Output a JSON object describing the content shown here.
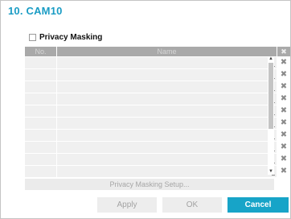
{
  "dialog": {
    "title": "10. CAM10"
  },
  "privacy_masking": {
    "label": "Privacy Masking",
    "checked": false
  },
  "table": {
    "columns": {
      "no": "No.",
      "name": "Name",
      "delete_icon": "close-icon"
    },
    "delete_glyph": "✖",
    "rows": [
      {
        "no": "",
        "name": ""
      },
      {
        "no": "",
        "name": ""
      },
      {
        "no": "",
        "name": ""
      },
      {
        "no": "",
        "name": ""
      },
      {
        "no": "",
        "name": ""
      },
      {
        "no": "",
        "name": ""
      },
      {
        "no": "",
        "name": ""
      },
      {
        "no": "",
        "name": ""
      },
      {
        "no": "",
        "name": ""
      },
      {
        "no": "",
        "name": ""
      }
    ]
  },
  "setup_button": "Privacy Masking Setup...",
  "buttons": {
    "apply": "Apply",
    "ok": "OK",
    "cancel": "Cancel"
  },
  "colors": {
    "accent": "#17a4c8",
    "title": "#1a9cc4",
    "header_bg": "#a9a9a9",
    "row_bg": "#f0f0f0"
  }
}
